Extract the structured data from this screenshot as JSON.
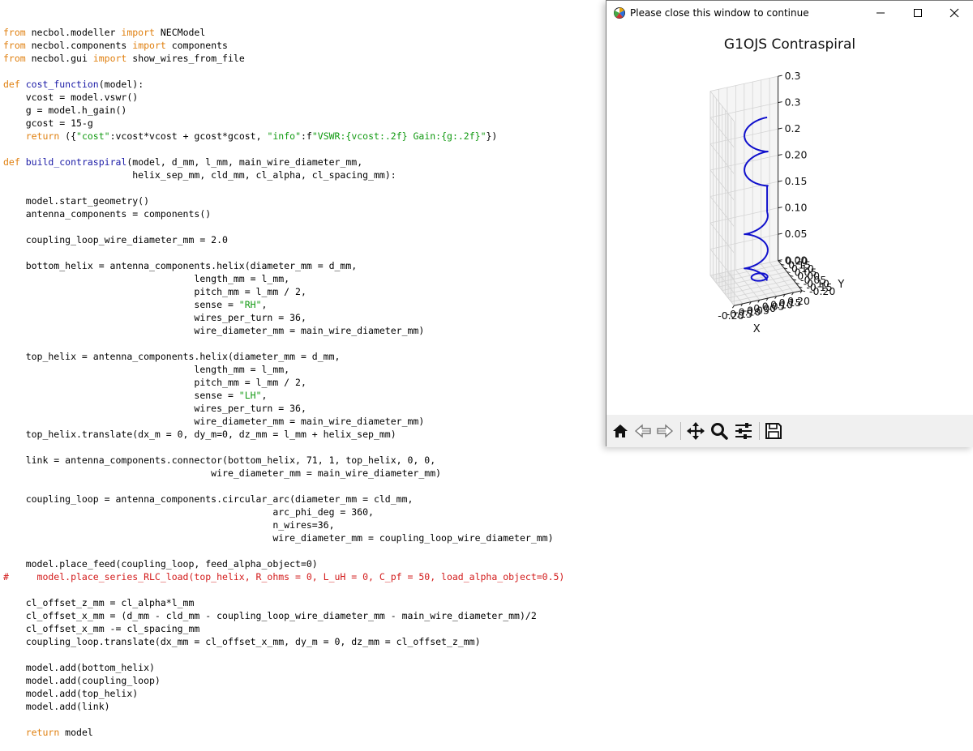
{
  "window": {
    "title": "Please close this window to continue",
    "figure_title": "G1OJS Contraspiral"
  },
  "code_lines": [
    [
      [
        "kw",
        "from"
      ],
      [
        "t",
        " necbol.modeller "
      ],
      [
        "kw",
        "import"
      ],
      [
        "t",
        " NECModel"
      ]
    ],
    [
      [
        "kw",
        "from"
      ],
      [
        "t",
        " necbol.components "
      ],
      [
        "kw",
        "import"
      ],
      [
        "t",
        " components"
      ]
    ],
    [
      [
        "kw",
        "from"
      ],
      [
        "t",
        " necbol.gui "
      ],
      [
        "kw",
        "import"
      ],
      [
        "t",
        " show_wires_from_file"
      ]
    ],
    [],
    [
      [
        "kw",
        "def"
      ],
      [
        "t",
        " "
      ],
      [
        "fn",
        "cost_function"
      ],
      [
        "t",
        "(model):"
      ]
    ],
    [
      [
        "t",
        "    vcost = model.vswr()"
      ]
    ],
    [
      [
        "t",
        "    g = model.h_gain()"
      ]
    ],
    [
      [
        "t",
        "    gcost = 15-g"
      ]
    ],
    [
      [
        "t",
        "    "
      ],
      [
        "kw",
        "return"
      ],
      [
        "t",
        " ({"
      ],
      [
        "str",
        "\"cost\""
      ],
      [
        "t",
        ":vcost*vcost + gcost*gcost, "
      ],
      [
        "str",
        "\"info\""
      ],
      [
        "t",
        ":f"
      ],
      [
        "str",
        "\"VSWR:{vcost:.2f} Gain:{g:.2f}\""
      ],
      [
        "t",
        "})"
      ]
    ],
    [],
    [
      [
        "kw",
        "def"
      ],
      [
        "t",
        " "
      ],
      [
        "fn",
        "build_contraspiral"
      ],
      [
        "t",
        "(model, d_mm, l_mm, main_wire_diameter_mm,"
      ]
    ],
    [
      [
        "t",
        "                       helix_sep_mm, cld_mm, cl_alpha, cl_spacing_mm):"
      ]
    ],
    [],
    [
      [
        "t",
        "    model.start_geometry()"
      ]
    ],
    [
      [
        "t",
        "    antenna_components = components()"
      ]
    ],
    [],
    [
      [
        "t",
        "    coupling_loop_wire_diameter_mm = 2.0"
      ]
    ],
    [],
    [
      [
        "t",
        "    bottom_helix = antenna_components.helix(diameter_mm = d_mm,"
      ]
    ],
    [
      [
        "t",
        "                                  length_mm = l_mm,"
      ]
    ],
    [
      [
        "t",
        "                                  pitch_mm = l_mm / 2,"
      ]
    ],
    [
      [
        "t",
        "                                  sense = "
      ],
      [
        "str",
        "\"RH\""
      ],
      [
        "t",
        ","
      ]
    ],
    [
      [
        "t",
        "                                  wires_per_turn = 36,"
      ]
    ],
    [
      [
        "t",
        "                                  wire_diameter_mm = main_wire_diameter_mm)"
      ]
    ],
    [],
    [
      [
        "t",
        "    top_helix = antenna_components.helix(diameter_mm = d_mm,"
      ]
    ],
    [
      [
        "t",
        "                                  length_mm = l_mm,"
      ]
    ],
    [
      [
        "t",
        "                                  pitch_mm = l_mm / 2,"
      ]
    ],
    [
      [
        "t",
        "                                  sense = "
      ],
      [
        "str",
        "\"LH\""
      ],
      [
        "t",
        ","
      ]
    ],
    [
      [
        "t",
        "                                  wires_per_turn = 36,"
      ]
    ],
    [
      [
        "t",
        "                                  wire_diameter_mm = main_wire_diameter_mm)"
      ]
    ],
    [
      [
        "t",
        "    top_helix.translate(dx_m = 0, dy_m=0, dz_mm = l_mm + helix_sep_mm)"
      ]
    ],
    [],
    [
      [
        "t",
        "    link = antenna_components.connector(bottom_helix, 71, 1, top_helix, 0, 0,"
      ]
    ],
    [
      [
        "t",
        "                                     wire_diameter_mm = main_wire_diameter_mm)"
      ]
    ],
    [],
    [
      [
        "t",
        "    coupling_loop = antenna_components.circular_arc(diameter_mm = cld_mm,"
      ]
    ],
    [
      [
        "t",
        "                                                arc_phi_deg = 360,"
      ]
    ],
    [
      [
        "t",
        "                                                n_wires=36,"
      ]
    ],
    [
      [
        "t",
        "                                                wire_diameter_mm = coupling_loop_wire_diameter_mm)"
      ]
    ],
    [],
    [
      [
        "t",
        "    model.place_feed(coupling_loop, feed_alpha_object=0)"
      ]
    ],
    [
      [
        "cm",
        "#     model.place_series_RLC_load(top_helix, R_ohms = 0, L_uH = 0, C_pf = 50, load_alpha_object=0.5)"
      ]
    ],
    [],
    [
      [
        "t",
        "    cl_offset_z_mm = cl_alpha*l_mm"
      ]
    ],
    [
      [
        "t",
        "    cl_offset_x_mm = (d_mm - cld_mm - coupling_loop_wire_diameter_mm - main_wire_diameter_mm)/2"
      ]
    ],
    [
      [
        "t",
        "    cl_offset_x_mm -= cl_spacing_mm"
      ]
    ],
    [
      [
        "t",
        "    coupling_loop.translate(dx_mm = cl_offset_x_mm, dy_m = 0, dz_mm = cl_offset_z_mm)"
      ]
    ],
    [],
    [
      [
        "t",
        "    model.add(bottom_helix)"
      ]
    ],
    [
      [
        "t",
        "    model.add(coupling_loop)"
      ]
    ],
    [
      [
        "t",
        "    model.add(top_helix)"
      ]
    ],
    [
      [
        "t",
        "    model.add(link)"
      ]
    ],
    [],
    [
      [
        "t",
        "    "
      ],
      [
        "kw",
        "return"
      ],
      [
        "t",
        " model"
      ]
    ]
  ],
  "chart_data": {
    "type": "line3d",
    "title": "G1OJS Contraspiral",
    "xlabel": "X",
    "ylabel": "Y",
    "zlabel": "",
    "x_ticks": [
      "-0.20",
      "-0.15",
      "-0.10",
      "-0.05",
      "0.00",
      "0.05",
      "0.10",
      "0.15",
      "0.20"
    ],
    "y_ticks": [
      "-0.20",
      "-0.15",
      "-0.10",
      "-0.05",
      "0.00",
      "0.05",
      "0.10",
      "0.15",
      "0.20"
    ],
    "z_ticks": [
      "0.00",
      "0.05",
      "0.10",
      "0.15",
      "0.20",
      "0.25",
      "0.30",
      "0.35"
    ],
    "z_ticks_displayed": [
      "0.00",
      "0.05",
      "0.10",
      "0.15",
      "0.20",
      "0.2",
      "0.3",
      "0.3"
    ],
    "xlim": [
      -0.2,
      0.2
    ],
    "ylim": [
      -0.2,
      0.2
    ],
    "zlim": [
      0,
      0.35
    ],
    "line_color": "#1010cc",
    "series": [
      {
        "component": "bottom_helix",
        "radius": 0.065,
        "z_start": 0.0,
        "z_end": 0.13,
        "turns": 2,
        "sense": "RH",
        "color": "#1010cc"
      },
      {
        "component": "top_helix",
        "radius": 0.065,
        "z_start": 0.18,
        "z_end": 0.31,
        "turns": 2,
        "sense": "LH",
        "color": "#1010cc"
      },
      {
        "component": "link",
        "from": [
          0.065,
          0.0,
          0.13
        ],
        "to": [
          0.065,
          0.0,
          0.18
        ],
        "color": "#1010cc"
      },
      {
        "component": "coupling_loop",
        "center_x": 0.02,
        "radius": 0.045,
        "z": 0.01,
        "color": "#1010cc"
      }
    ],
    "grid": true
  },
  "toolbar": {
    "icons": [
      "home-icon",
      "back-icon",
      "forward-icon",
      "pan-icon",
      "zoom-icon",
      "configure-icon",
      "save-icon"
    ]
  },
  "colors": {
    "keyword": "#e08010",
    "function": "#1a1aa6",
    "string": "#129a12",
    "comment": "#d21a1a",
    "plot_line": "#1010cc"
  }
}
